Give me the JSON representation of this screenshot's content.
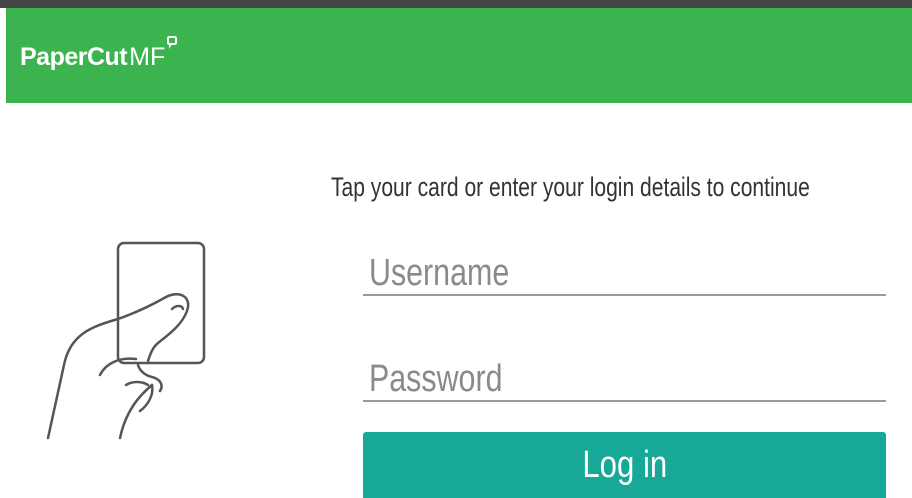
{
  "header": {
    "logo_main": "PaperCut",
    "logo_suffix": "MF",
    "background_color": "#3bb44f"
  },
  "login": {
    "prompt": "Tap your card or enter your login details to continue",
    "username_placeholder": "Username",
    "password_placeholder": "Password",
    "button_label": "Log in",
    "button_color": "#17a897"
  },
  "illustration": {
    "icon": "hand-holding-card-icon"
  }
}
